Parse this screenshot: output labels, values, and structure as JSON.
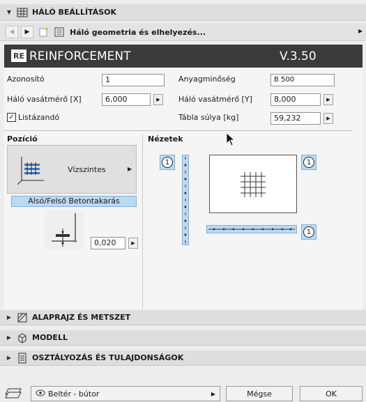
{
  "header": {
    "title": "HÁLÓ BEÁLLÍTÁSOK"
  },
  "nav": {
    "dropdown": "Háló geometria és elhelyezés..."
  },
  "banner": {
    "brand": "REINFORCEMENT",
    "version": "V.3.50",
    "logo": "RE"
  },
  "fields": {
    "azonosito_label": "Azonosító",
    "azonosito_value": "1",
    "vasatmero_x_label": "Háló vasátmérő [X]",
    "vasatmero_x_value": "6,000",
    "listazando_label": "Listázandó",
    "anyag_label": "Anyagminőség",
    "anyag_value": "B 500",
    "vasatmero_y_label": "Háló vasátmérő [Y]",
    "vasatmero_y_value": "8,000",
    "tabla_label": "Tábla súlya [kg]",
    "tabla_value": "59,232"
  },
  "pozicio": {
    "label": "Pozíció",
    "placement": "Vízszintes",
    "cover_label": "Alsó/Felső Betontakarás",
    "cover_value": "0,020"
  },
  "nezetek": {
    "label": "Nézetek",
    "view_id": "1"
  },
  "sections": {
    "alaprajz": "ALAPRAJZ ÉS METSZET",
    "modell": "MODELL",
    "osztalyozas": "OSZTÁLYOZÁS ÉS TULAJDONSÁGOK"
  },
  "footer": {
    "layer": "Beltér - bútor",
    "cancel": "Mégse",
    "ok": "OK"
  },
  "colors": {
    "banner_bg": "#3a3a3a",
    "accent_blue": "#bcd9f2",
    "panel_bg": "#f5f5f5"
  }
}
